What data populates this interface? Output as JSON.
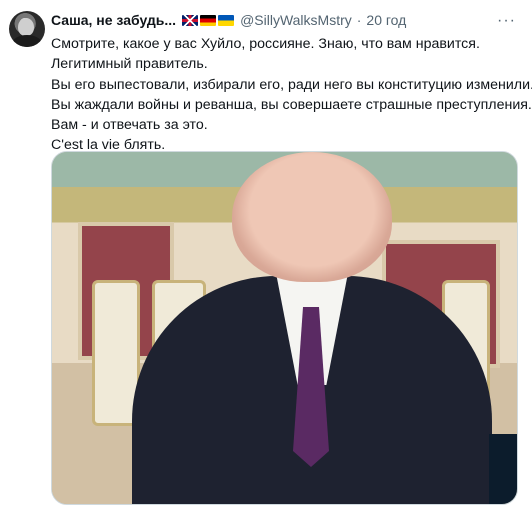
{
  "tweet": {
    "author_name": "Саша, не забудь...",
    "flags": [
      "flag-uk",
      "flag-de",
      "flag-ua"
    ],
    "handle": "@SillyWalksMstry",
    "separator": "·",
    "time": "20 год",
    "more_icon": "···",
    "text_lines": [
      "Смотрите, какое у вас Хуйло, россияне. Знаю, что вам нравится.",
      "Легитимный правитель.",
      "Вы его выпестовали, избирали его, ради него вы конституцию изменили.",
      "Вы жаждали войны и реванша, вы совершаете страшные преступления.",
      "Вам - и отвечать за это.",
      "C'est la vie блять."
    ]
  },
  "colors": {
    "text": "#0f1419",
    "secondary": "#536471",
    "border": "#cfd9de"
  }
}
